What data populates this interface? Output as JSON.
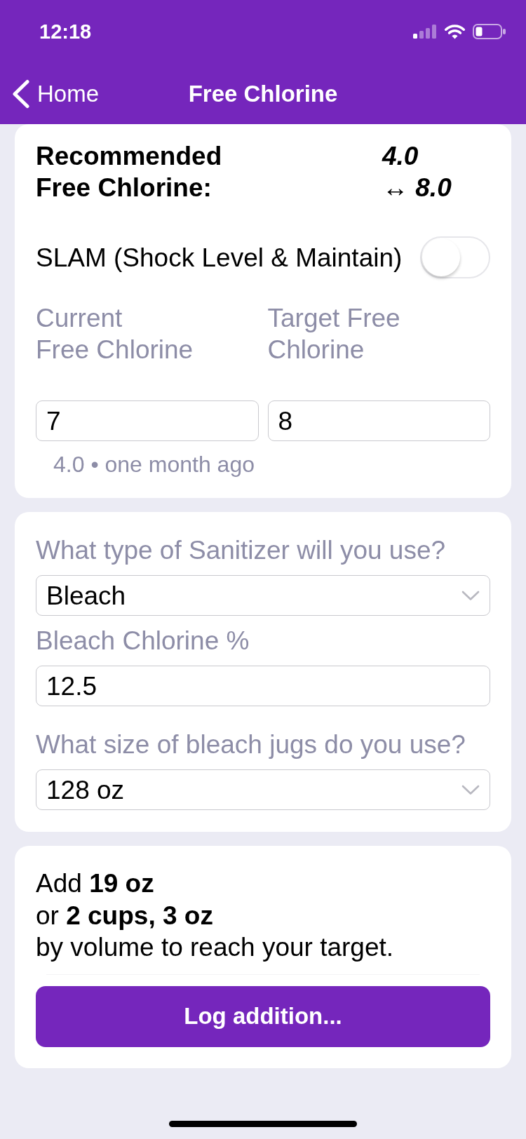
{
  "status_bar": {
    "time": "12:18"
  },
  "nav_bar": {
    "back_label": "Home",
    "title": "Free Chlorine"
  },
  "recommendation": {
    "label": "Recommended\nFree Chlorine:",
    "value": "4.0\n↔ 8.0"
  },
  "slam": {
    "label": "SLAM (Shock Level & Maintain)",
    "on": false
  },
  "readings": [
    {
      "label": "Current\nFree Chlorine",
      "value": "7",
      "hint": "4.0 • one month ago"
    },
    {
      "label": "Target Free\nChlorine",
      "value": "8"
    }
  ],
  "sanitizer_fields": [
    {
      "kind": "select",
      "label": "What type of Sanitizer will you use?",
      "value": "Bleach"
    },
    {
      "kind": "input",
      "label": "Bleach Chlorine %",
      "value": "12.5"
    },
    {
      "kind": "select",
      "label": "What size of bleach jugs do you use?",
      "value": "128 oz"
    }
  ],
  "result": {
    "text": "Add **19 oz**\nor **2 cups, 3 oz**\nby volume to reach your target.",
    "button": "Log addition..."
  }
}
